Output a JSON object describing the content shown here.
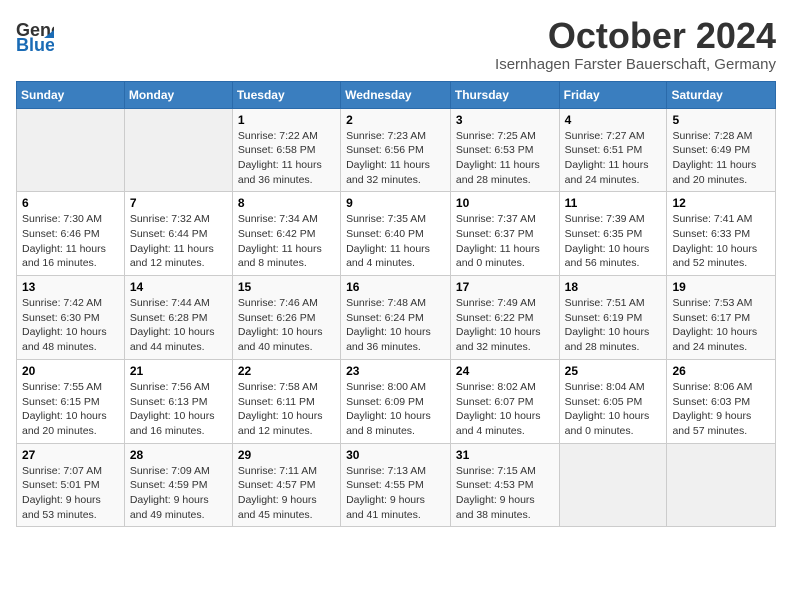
{
  "header": {
    "logo_line1": "General",
    "logo_line2": "Blue",
    "month_title": "October 2024",
    "subtitle": "Isernhagen Farster Bauerschaft, Germany"
  },
  "days_of_week": [
    "Sunday",
    "Monday",
    "Tuesday",
    "Wednesday",
    "Thursday",
    "Friday",
    "Saturday"
  ],
  "weeks": [
    [
      {
        "day": "",
        "sunrise": "",
        "sunset": "",
        "daylight": ""
      },
      {
        "day": "",
        "sunrise": "",
        "sunset": "",
        "daylight": ""
      },
      {
        "day": "1",
        "sunrise": "Sunrise: 7:22 AM",
        "sunset": "Sunset: 6:58 PM",
        "daylight": "Daylight: 11 hours and 36 minutes."
      },
      {
        "day": "2",
        "sunrise": "Sunrise: 7:23 AM",
        "sunset": "Sunset: 6:56 PM",
        "daylight": "Daylight: 11 hours and 32 minutes."
      },
      {
        "day": "3",
        "sunrise": "Sunrise: 7:25 AM",
        "sunset": "Sunset: 6:53 PM",
        "daylight": "Daylight: 11 hours and 28 minutes."
      },
      {
        "day": "4",
        "sunrise": "Sunrise: 7:27 AM",
        "sunset": "Sunset: 6:51 PM",
        "daylight": "Daylight: 11 hours and 24 minutes."
      },
      {
        "day": "5",
        "sunrise": "Sunrise: 7:28 AM",
        "sunset": "Sunset: 6:49 PM",
        "daylight": "Daylight: 11 hours and 20 minutes."
      }
    ],
    [
      {
        "day": "6",
        "sunrise": "Sunrise: 7:30 AM",
        "sunset": "Sunset: 6:46 PM",
        "daylight": "Daylight: 11 hours and 16 minutes."
      },
      {
        "day": "7",
        "sunrise": "Sunrise: 7:32 AM",
        "sunset": "Sunset: 6:44 PM",
        "daylight": "Daylight: 11 hours and 12 minutes."
      },
      {
        "day": "8",
        "sunrise": "Sunrise: 7:34 AM",
        "sunset": "Sunset: 6:42 PM",
        "daylight": "Daylight: 11 hours and 8 minutes."
      },
      {
        "day": "9",
        "sunrise": "Sunrise: 7:35 AM",
        "sunset": "Sunset: 6:40 PM",
        "daylight": "Daylight: 11 hours and 4 minutes."
      },
      {
        "day": "10",
        "sunrise": "Sunrise: 7:37 AM",
        "sunset": "Sunset: 6:37 PM",
        "daylight": "Daylight: 11 hours and 0 minutes."
      },
      {
        "day": "11",
        "sunrise": "Sunrise: 7:39 AM",
        "sunset": "Sunset: 6:35 PM",
        "daylight": "Daylight: 10 hours and 56 minutes."
      },
      {
        "day": "12",
        "sunrise": "Sunrise: 7:41 AM",
        "sunset": "Sunset: 6:33 PM",
        "daylight": "Daylight: 10 hours and 52 minutes."
      }
    ],
    [
      {
        "day": "13",
        "sunrise": "Sunrise: 7:42 AM",
        "sunset": "Sunset: 6:30 PM",
        "daylight": "Daylight: 10 hours and 48 minutes."
      },
      {
        "day": "14",
        "sunrise": "Sunrise: 7:44 AM",
        "sunset": "Sunset: 6:28 PM",
        "daylight": "Daylight: 10 hours and 44 minutes."
      },
      {
        "day": "15",
        "sunrise": "Sunrise: 7:46 AM",
        "sunset": "Sunset: 6:26 PM",
        "daylight": "Daylight: 10 hours and 40 minutes."
      },
      {
        "day": "16",
        "sunrise": "Sunrise: 7:48 AM",
        "sunset": "Sunset: 6:24 PM",
        "daylight": "Daylight: 10 hours and 36 minutes."
      },
      {
        "day": "17",
        "sunrise": "Sunrise: 7:49 AM",
        "sunset": "Sunset: 6:22 PM",
        "daylight": "Daylight: 10 hours and 32 minutes."
      },
      {
        "day": "18",
        "sunrise": "Sunrise: 7:51 AM",
        "sunset": "Sunset: 6:19 PM",
        "daylight": "Daylight: 10 hours and 28 minutes."
      },
      {
        "day": "19",
        "sunrise": "Sunrise: 7:53 AM",
        "sunset": "Sunset: 6:17 PM",
        "daylight": "Daylight: 10 hours and 24 minutes."
      }
    ],
    [
      {
        "day": "20",
        "sunrise": "Sunrise: 7:55 AM",
        "sunset": "Sunset: 6:15 PM",
        "daylight": "Daylight: 10 hours and 20 minutes."
      },
      {
        "day": "21",
        "sunrise": "Sunrise: 7:56 AM",
        "sunset": "Sunset: 6:13 PM",
        "daylight": "Daylight: 10 hours and 16 minutes."
      },
      {
        "day": "22",
        "sunrise": "Sunrise: 7:58 AM",
        "sunset": "Sunset: 6:11 PM",
        "daylight": "Daylight: 10 hours and 12 minutes."
      },
      {
        "day": "23",
        "sunrise": "Sunrise: 8:00 AM",
        "sunset": "Sunset: 6:09 PM",
        "daylight": "Daylight: 10 hours and 8 minutes."
      },
      {
        "day": "24",
        "sunrise": "Sunrise: 8:02 AM",
        "sunset": "Sunset: 6:07 PM",
        "daylight": "Daylight: 10 hours and 4 minutes."
      },
      {
        "day": "25",
        "sunrise": "Sunrise: 8:04 AM",
        "sunset": "Sunset: 6:05 PM",
        "daylight": "Daylight: 10 hours and 0 minutes."
      },
      {
        "day": "26",
        "sunrise": "Sunrise: 8:06 AM",
        "sunset": "Sunset: 6:03 PM",
        "daylight": "Daylight: 9 hours and 57 minutes."
      }
    ],
    [
      {
        "day": "27",
        "sunrise": "Sunrise: 7:07 AM",
        "sunset": "Sunset: 5:01 PM",
        "daylight": "Daylight: 9 hours and 53 minutes."
      },
      {
        "day": "28",
        "sunrise": "Sunrise: 7:09 AM",
        "sunset": "Sunset: 4:59 PM",
        "daylight": "Daylight: 9 hours and 49 minutes."
      },
      {
        "day": "29",
        "sunrise": "Sunrise: 7:11 AM",
        "sunset": "Sunset: 4:57 PM",
        "daylight": "Daylight: 9 hours and 45 minutes."
      },
      {
        "day": "30",
        "sunrise": "Sunrise: 7:13 AM",
        "sunset": "Sunset: 4:55 PM",
        "daylight": "Daylight: 9 hours and 41 minutes."
      },
      {
        "day": "31",
        "sunrise": "Sunrise: 7:15 AM",
        "sunset": "Sunset: 4:53 PM",
        "daylight": "Daylight: 9 hours and 38 minutes."
      },
      {
        "day": "",
        "sunrise": "",
        "sunset": "",
        "daylight": ""
      },
      {
        "day": "",
        "sunrise": "",
        "sunset": "",
        "daylight": ""
      }
    ]
  ]
}
